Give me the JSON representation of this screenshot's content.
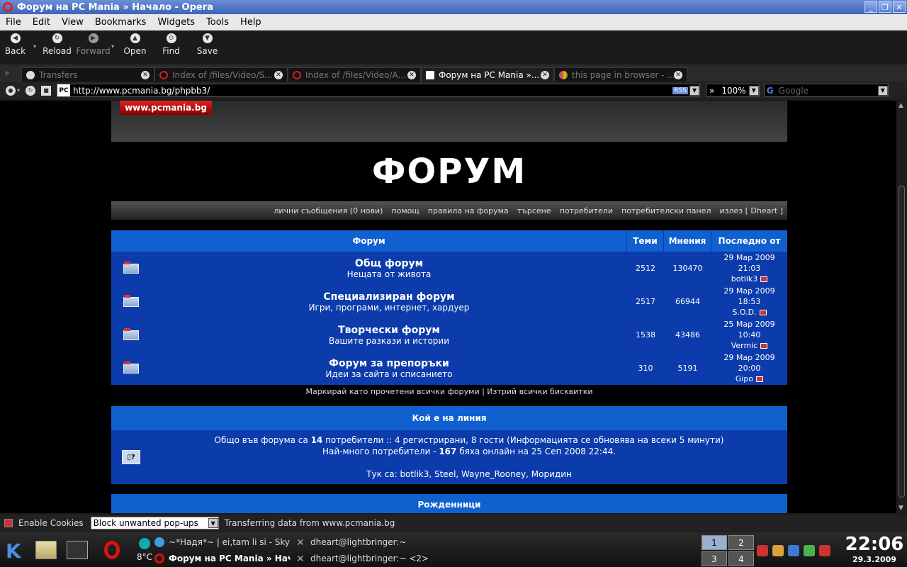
{
  "window": {
    "title": "Форум на PC Mania » Начало - Opera"
  },
  "menu": [
    "File",
    "Edit",
    "View",
    "Bookmarks",
    "Widgets",
    "Tools",
    "Help"
  ],
  "toolbar": {
    "back": "Back",
    "reload": "Reload",
    "forward": "Forward",
    "open": "Open",
    "find": "Find",
    "save": "Save"
  },
  "tabs": [
    {
      "label": "Transfers",
      "active": false
    },
    {
      "label": "Index of /files/Video/S...",
      "active": false
    },
    {
      "label": "Index of /files/Video/A...",
      "active": false
    },
    {
      "label": "Форум на PC Mania »...",
      "active": true
    },
    {
      "label": "this page in browser - ...",
      "active": false
    }
  ],
  "address": {
    "url": "http://www.pcmania.bg/phpbb3/",
    "rss": "RSS",
    "zoom": "100%",
    "search_placeholder": "Google"
  },
  "page": {
    "logo": "www.pcmania.bg",
    "title": "ФОРУМ",
    "nav": [
      "лични съобщения (0 нови)",
      "помощ",
      "правила на форума",
      "търсене",
      "потребители",
      "потребителски панел",
      "излез [ Dheart ]"
    ],
    "table_headers": {
      "forum": "Форум",
      "topics": "Теми",
      "posts": "Мнения",
      "last": "Последно от"
    },
    "forums": [
      {
        "name": "Общ форум",
        "desc": "Нещата от живота",
        "topics": "2512",
        "posts": "130470",
        "last_date": "29 Мар 2009 21:03",
        "last_user": "botlik3"
      },
      {
        "name": "Специализиран форум",
        "desc": "Игри, програми, интернет, хардуер",
        "topics": "2517",
        "posts": "66944",
        "last_date": "29 Мар 2009 18:53",
        "last_user": "S.O.D."
      },
      {
        "name": "Творчески форум",
        "desc": "Вашите разкази и истории",
        "topics": "1538",
        "posts": "43486",
        "last_date": "25 Мар 2009 10:40",
        "last_user": "Vermic"
      },
      {
        "name": "Форум за препоръки",
        "desc": "Идеи за сайта и списанието",
        "topics": "310",
        "posts": "5191",
        "last_date": "29 Мар 2009 20:00",
        "last_user": "Gipo"
      }
    ],
    "mark_links": "Маркирай като прочетени всички форуми | Изтрий всички бисквитки",
    "online": {
      "title": "Кой е на линия",
      "line1_pre": "Общо във форума са ",
      "line1_count": "14",
      "line1_post": " потребители :: 4 регистрирани, 8 гости (Информацията се обновява на всеки 5 минути)",
      "line2_pre": "Най-много потребители - ",
      "line2_count": "167",
      "line2_post": " бяха онлайн на 25 Сеп 2008 22:44.",
      "users": "Тук са: botlik3, Steel, Wayne_Rooney, Моридин"
    },
    "birthdays_title": "Рожденници"
  },
  "status": {
    "cookies": "Enable Cookies",
    "popups": "Block unwanted pop-ups",
    "message": "Transferring data from www.pcmania.bg"
  },
  "taskbar": {
    "weather": "8°C",
    "tasks": [
      {
        "label": "~*Надя*~ | ei,tam li si - Skyp",
        "active": false
      },
      {
        "label": "dheart@lightbringer:~",
        "active": false
      },
      {
        "label": "Форум на PC Mania » Нач",
        "active": true
      },
      {
        "label": "dheart@lightbringer:~ <2>",
        "active": false
      }
    ],
    "pager": [
      "1",
      "2",
      "3",
      "4"
    ],
    "time": "22:06",
    "date": "29.3.2009"
  },
  "colors": {
    "header_blue": "#1060d0",
    "row_blue": "#0c3cac",
    "logo_red": "#cc2222"
  }
}
